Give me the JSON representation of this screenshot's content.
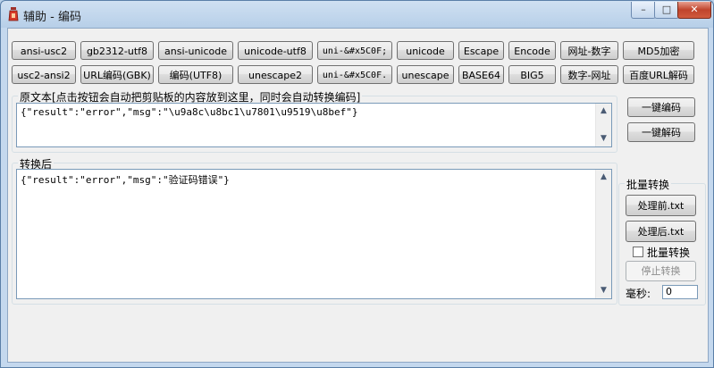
{
  "window": {
    "title": "辅助 - 编码",
    "min": "–",
    "max": "□",
    "close": "✕"
  },
  "row1": [
    "ansi-usc2",
    "gb2312-utf8",
    "ansi-unicode",
    "unicode-utf8",
    "uni-&#x5C0F;",
    "unicode",
    "Escape",
    "Encode",
    "网址-数字",
    "MD5加密"
  ],
  "row2": [
    "usc2-ansi2",
    "URL编码(GBK)",
    "编码(UTF8)",
    "unescape2",
    "uni-&#x5C0F.",
    "unescape",
    "BASE64",
    "BIG5",
    "数字-网址",
    "百度URL解码"
  ],
  "source": {
    "label": "原文本[点击按钮会自动把剪贴板的内容放到这里，同时会自动转换编码]",
    "text": "{\"result\":\"error\",\"msg\":\"\\u9a8c\\u8bc1\\u7801\\u9519\\u8bef\"}"
  },
  "result": {
    "label": "转换后",
    "text": "{\"result\":\"error\",\"msg\":\"验证码错误\"}"
  },
  "side": {
    "encode_all": "一键编码",
    "decode_all": "一键解码"
  },
  "batch": {
    "label": "批量转换",
    "before": "处理前.txt",
    "after": "处理后.txt",
    "checkbox_label": "批量转换",
    "stop": "停止转换",
    "ms_label": "毫秒:",
    "ms_value": "0"
  },
  "colors": {
    "title_bg": "#c4d8ee",
    "client_bg": "#f0f0f0",
    "close_btn": "#c0442c"
  }
}
